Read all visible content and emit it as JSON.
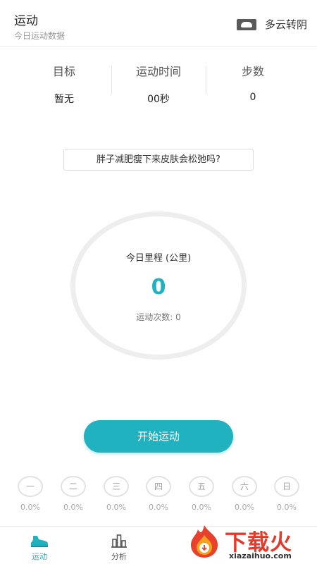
{
  "header": {
    "title": "运动",
    "subtitle": "今日运动数据",
    "weather_icon": "cloud-icon",
    "weather_label": "多云转阴"
  },
  "stats": [
    {
      "label": "目标",
      "value": "暂无"
    },
    {
      "label": "运动时间",
      "value": "00秒"
    },
    {
      "label": "步数",
      "value": "0"
    }
  ],
  "tip": "胖子减肥瘦下来皮肤会松弛吗?",
  "mileage": {
    "title": "今日里程 (公里)",
    "value": "0",
    "count_label": "运动次数: 0"
  },
  "start_button": "开始运动",
  "weekdays": [
    {
      "day": "一",
      "pct": "0.0%"
    },
    {
      "day": "二",
      "pct": "0.0%"
    },
    {
      "day": "三",
      "pct": "0.0%"
    },
    {
      "day": "四",
      "pct": "0.0%"
    },
    {
      "day": "五",
      "pct": "0.0%"
    },
    {
      "day": "六",
      "pct": "0.0%"
    },
    {
      "day": "日",
      "pct": "0.0%"
    }
  ],
  "tabs": [
    {
      "label": "运动",
      "icon": "shoe-icon",
      "active": true
    },
    {
      "label": "分析",
      "icon": "bar-chart-icon",
      "active": false
    }
  ],
  "watermark": {
    "text": "下载火",
    "url": "xiazaihuo.com"
  },
  "colors": {
    "accent": "#20b2be",
    "ring": "#eeeeee",
    "watermark": "#e23b2b"
  }
}
